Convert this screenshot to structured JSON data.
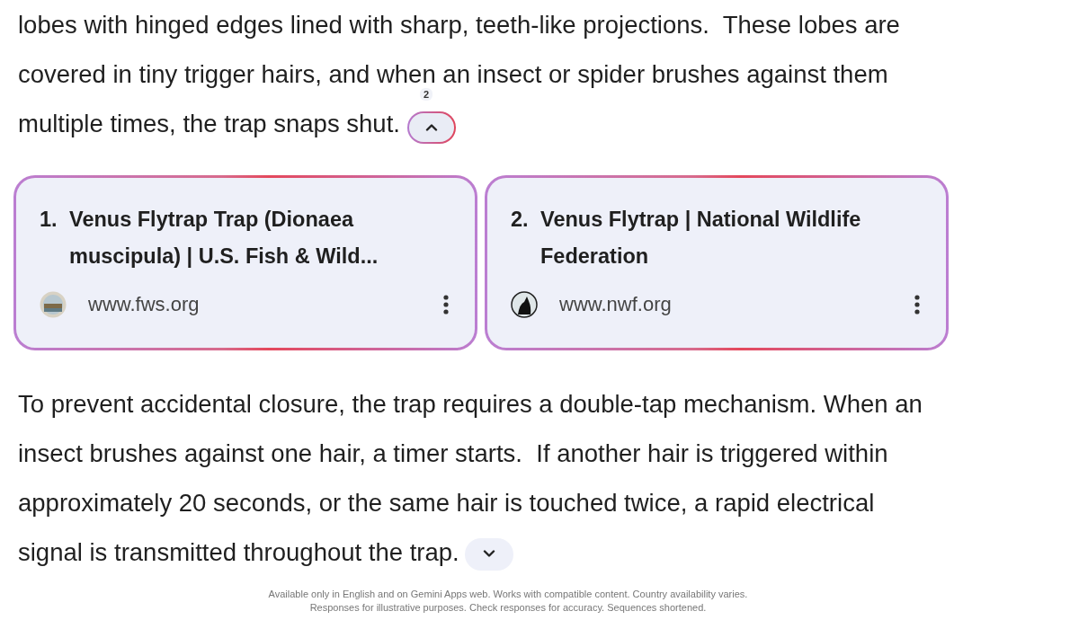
{
  "paragraphs": [
    {
      "lines": [
        "lobes with hinged edges lined with sharp, teeth-like projections.  These lobes are",
        "covered in tiny trigger hairs, and when an insect or spider brushes against them",
        "multiple times, the trap snaps shut."
      ],
      "citation": "2",
      "sources_expanded": true
    },
    {
      "lines": [
        "To prevent accidental closure, the trap requires a double-tap mechanism. When an",
        "insect brushes against one hair, a timer starts.  If another hair is triggered within",
        "approximately 20 seconds, or the same hair is touched twice, a rapid electrical",
        "signal is transmitted throughout the trap."
      ],
      "sources_expanded": false
    }
  ],
  "sources": [
    {
      "number": "1.",
      "title_lines": [
        "Venus Flytrap Trap (Dionaea",
        "muscipula) | U.S. Fish & Wild..."
      ],
      "domain": "www.fws.org",
      "kind": "seal"
    },
    {
      "number": "2.",
      "title_lines": [
        "Venus Flytrap | National Wildlife",
        "Federation"
      ],
      "domain": "www.nwf.org",
      "kind": "silhouette"
    }
  ],
  "disclaimer": [
    "Available only in English and on Gemini Apps web. Works with compatible content. Country availability varies.",
    "Responses for illustrative purposes. Check responses for accuracy. Sequences shortened."
  ]
}
